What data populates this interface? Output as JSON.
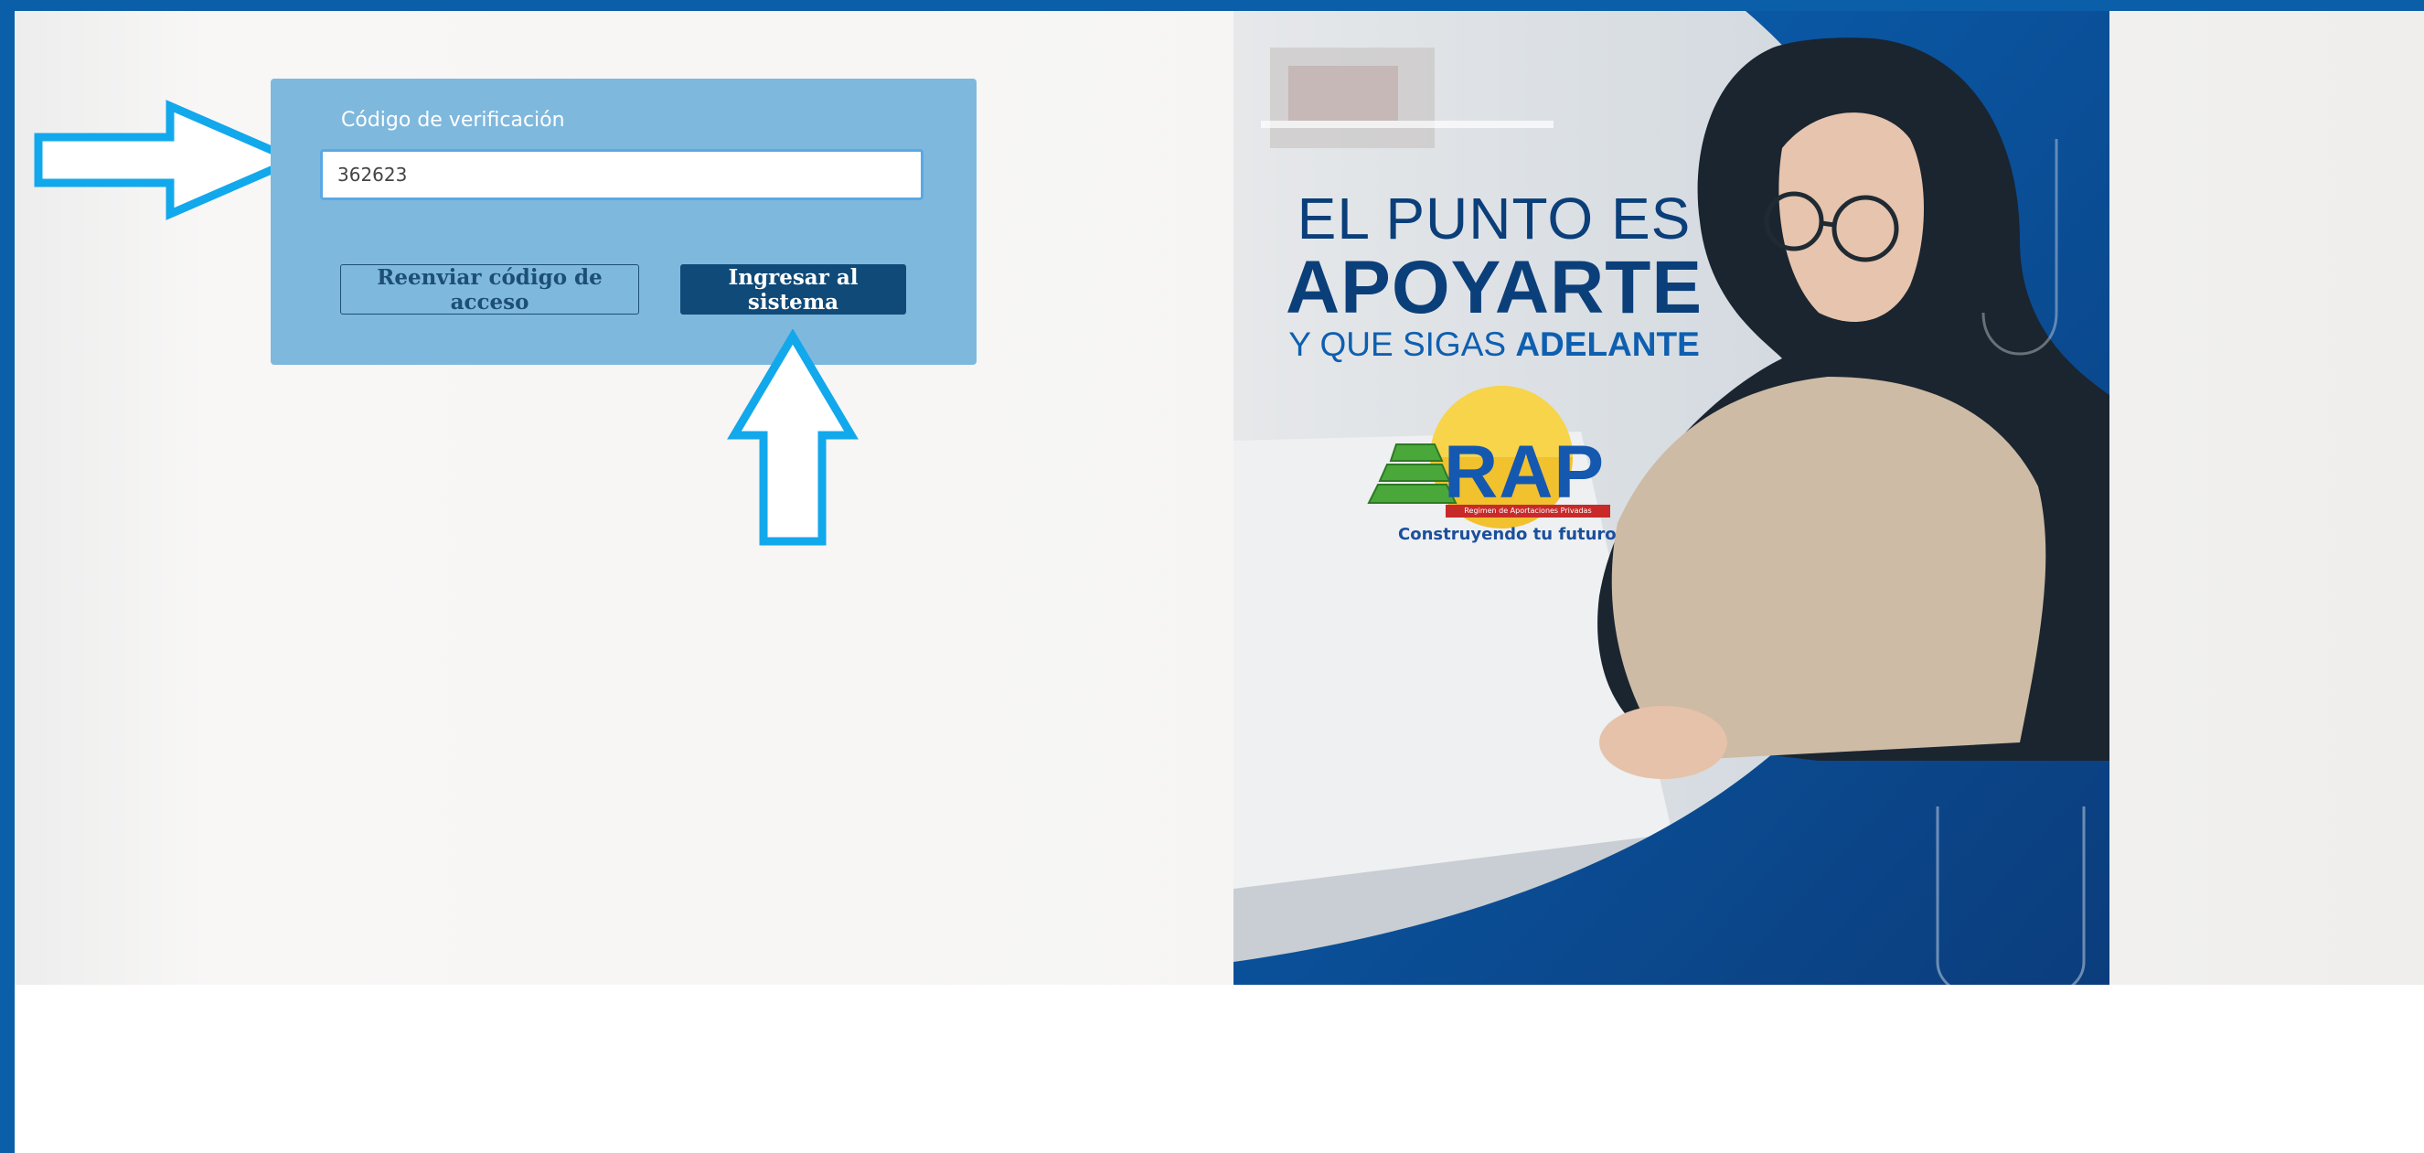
{
  "login": {
    "code_label": "Código de verificación",
    "code_value": "362623",
    "resend_label": "Reenviar código de acceso",
    "submit_label": "Ingresar al sistema"
  },
  "promo": {
    "line1": "EL PUNTO ES",
    "line2": "APOYARTE",
    "line3_prefix": "Y QUE SIGAS ",
    "line3_emphasis": "ADELANTE",
    "logo_text": "RAP",
    "logo_subtitle": "Regimen de Aportaciones Privadas",
    "logo_tagline": "Construyendo tu futuro"
  },
  "colors": {
    "frame_border": "#0b5fa8",
    "card": "#7fb8dd",
    "primary_button": "#0f4a78",
    "annotation_arrow": "#12a8ec",
    "brand_blue": "#0b3f7a"
  },
  "icons": [
    "arrow-right-annotation-icon",
    "arrow-up-annotation-icon"
  ]
}
